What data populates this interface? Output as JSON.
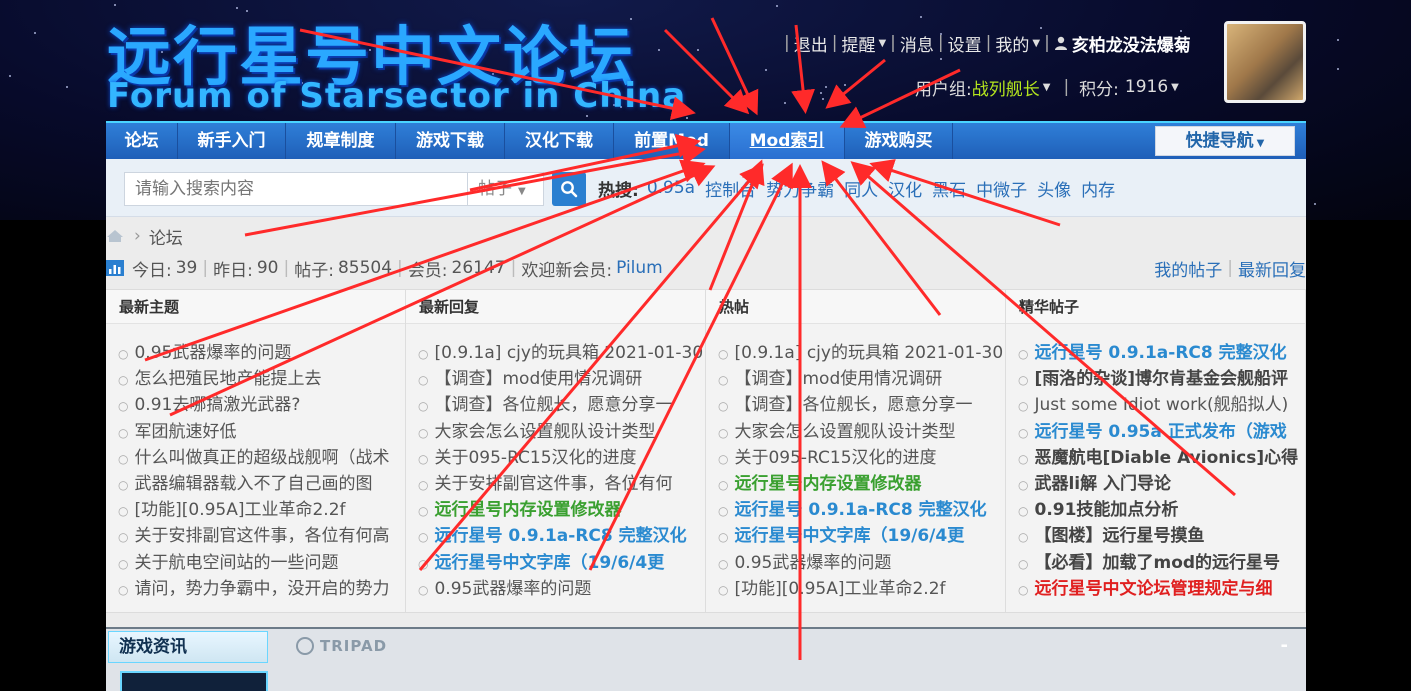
{
  "logo": {
    "cn": "远行星号中文论坛",
    "en": "Forum of Starsector in China"
  },
  "userbar": {
    "links": [
      "退出",
      "提醒",
      "消息",
      "设置",
      "我的"
    ],
    "username": "亥柏龙没法爆菊"
  },
  "userinfo": {
    "group_label": "用户组:",
    "group": "战列舰长",
    "points_label": "积分:",
    "points": "1916"
  },
  "nav": {
    "items": [
      "论坛",
      "新手入门",
      "规章制度",
      "游戏下载",
      "汉化下载",
      "前置Mod",
      "Mod索引",
      "游戏购买"
    ],
    "active": "Mod索引",
    "quicknav": "快捷导航"
  },
  "search": {
    "placeholder": "请输入搜索内容",
    "type": "帖子",
    "hot_label": "热搜:",
    "hot": [
      "0.95a",
      "控制台",
      "势力争霸",
      "同人",
      "汉化",
      "黑石",
      "中微子",
      "头像",
      "内存"
    ]
  },
  "breadcrumb": {
    "current": "论坛"
  },
  "stats": {
    "today_label": "今日:",
    "today": "39",
    "yesterday_label": "昨日:",
    "yesterday": "90",
    "posts_label": "帖子:",
    "posts": "85504",
    "members_label": "会员:",
    "members": "26147",
    "welcome_label": "欢迎新会员:",
    "newest": "Pilum",
    "my_posts": "我的帖子",
    "latest_replies": "最新回复"
  },
  "columns": [
    {
      "title": "最新主题",
      "items": [
        {
          "text": "0.95武器爆率的问题",
          "style": ""
        },
        {
          "text": "怎么把殖民地产能提上去",
          "style": ""
        },
        {
          "text": "0.91去哪搞激光武器?",
          "style": ""
        },
        {
          "text": "军团航速好低",
          "style": ""
        },
        {
          "text": "什么叫做真正的超级战舰啊（战术",
          "style": ""
        },
        {
          "text": "武器编辑器载入不了自己画的图",
          "style": ""
        },
        {
          "text": "[功能][0.95A]工业革命2.2f",
          "style": ""
        },
        {
          "text": "关于安排副官这件事，各位有何高",
          "style": ""
        },
        {
          "text": "关于航电空间站的一些问题",
          "style": ""
        },
        {
          "text": "请问，势力争霸中，没开启的势力",
          "style": ""
        }
      ]
    },
    {
      "title": "最新回复",
      "items": [
        {
          "text": "[0.9.1a] cjy的玩具箱 2021-01-30",
          "style": ""
        },
        {
          "text": "【调查】mod使用情况调研",
          "style": ""
        },
        {
          "text": "【调查】各位舰长，愿意分享一",
          "style": ""
        },
        {
          "text": "大家会怎么设置舰队设计类型",
          "style": ""
        },
        {
          "text": "关于095-RC15汉化的进度",
          "style": ""
        },
        {
          "text": "关于安排副官这件事，各位有何",
          "style": ""
        },
        {
          "text": "远行星号内存设置修改器",
          "style": "green"
        },
        {
          "text": "远行星号 0.9.1a-RC8 完整汉化",
          "style": "blue"
        },
        {
          "text": "远行星号中文字库（19/6/4更",
          "style": "blue"
        },
        {
          "text": "0.95武器爆率的问题",
          "style": ""
        }
      ]
    },
    {
      "title": "热帖",
      "items": [
        {
          "text": "[0.9.1a] cjy的玩具箱 2021-01-30",
          "style": ""
        },
        {
          "text": "【调查】mod使用情况调研",
          "style": ""
        },
        {
          "text": "【调查】各位舰长，愿意分享一",
          "style": ""
        },
        {
          "text": "大家会怎么设置舰队设计类型",
          "style": ""
        },
        {
          "text": "关于095-RC15汉化的进度",
          "style": ""
        },
        {
          "text": "远行星号内存设置修改器",
          "style": "green"
        },
        {
          "text": "远行星号 0.9.1a-RC8 完整汉化",
          "style": "blue"
        },
        {
          "text": "远行星号中文字库（19/6/4更",
          "style": "blue"
        },
        {
          "text": "0.95武器爆率的问题",
          "style": ""
        },
        {
          "text": "[功能][0.95A]工业革命2.2f",
          "style": ""
        }
      ]
    },
    {
      "title": "精华帖子",
      "items": [
        {
          "text": "远行星号 0.9.1a-RC8 完整汉化",
          "style": "blue"
        },
        {
          "text": "[雨洛的杂谈]博尔肯基金会舰船评",
          "style": "dark"
        },
        {
          "text": "Just some Idiot work(舰船拟人)",
          "style": ""
        },
        {
          "text": "远行星号 0.95a 正式发布（游戏",
          "style": "blue"
        },
        {
          "text": "恶魔航电[Diable Avionics]心得",
          "style": "dark"
        },
        {
          "text": "武器li解 入门导论",
          "style": "dark"
        },
        {
          "text": "0.91技能加点分析",
          "style": "dark"
        },
        {
          "text": "【图楼】远行星号摸鱼",
          "style": "dark"
        },
        {
          "text": "【必看】加载了mod的远行星号",
          "style": "dark"
        },
        {
          "text": "远行星号中文论坛管理规定与细",
          "style": "red"
        }
      ]
    }
  ],
  "news": {
    "tab": "游戏资讯",
    "brand": "TRIPAD",
    "collapse": "-"
  },
  "colors": {
    "nav": "#2f7fd8",
    "link": "#2a6fb8",
    "accent_green": "#b5e61d",
    "arrow": "#ff2a2a"
  }
}
